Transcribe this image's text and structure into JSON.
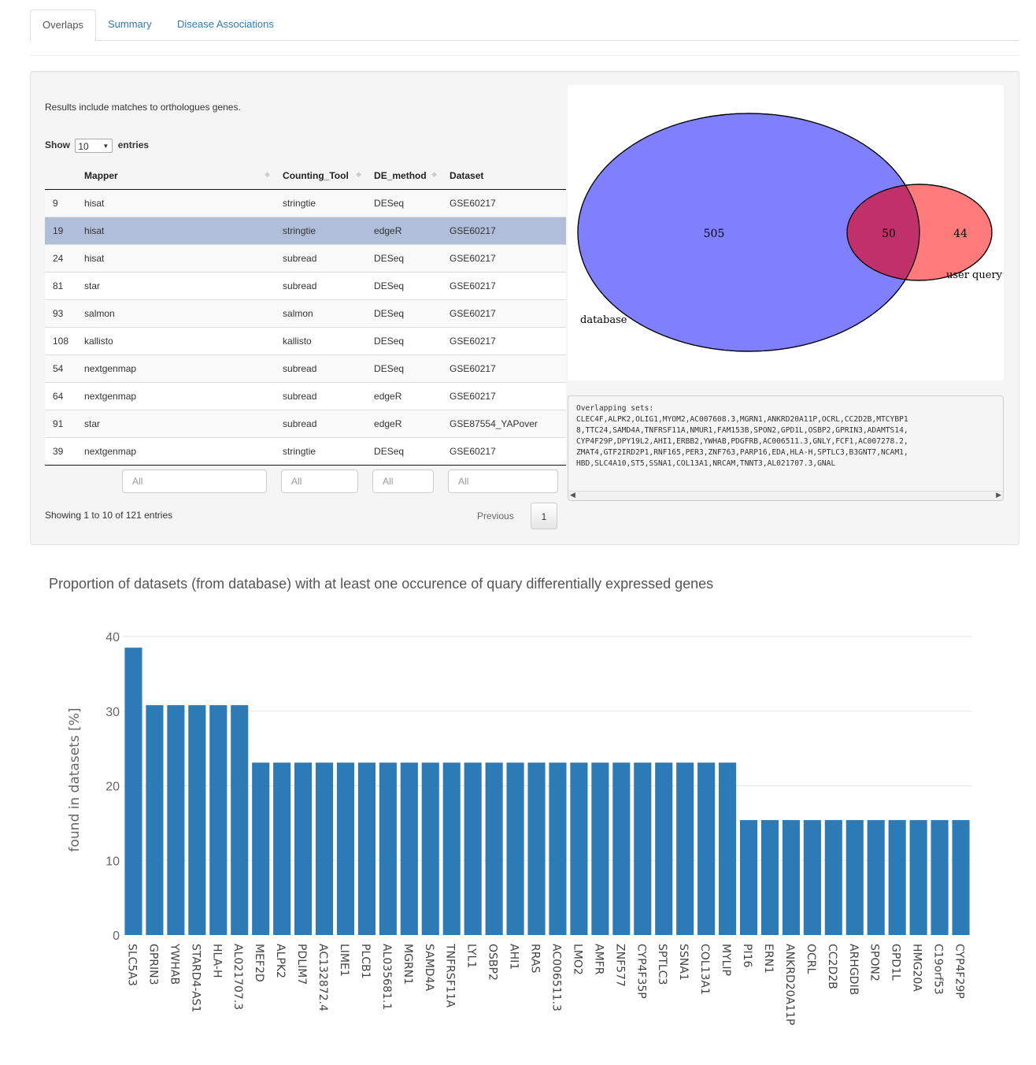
{
  "tabs": [
    {
      "label": "Overlaps",
      "active": true
    },
    {
      "label": "Summary",
      "active": false
    },
    {
      "label": "Disease Associations",
      "active": false
    }
  ],
  "results_note": "Results include matches to orthologues genes.",
  "length_control": {
    "show": "Show",
    "value": "10",
    "entries": "entries"
  },
  "table": {
    "columns": [
      "",
      "Mapper",
      "Counting_Tool",
      "DE_method",
      "Dataset"
    ],
    "rows": [
      {
        "id": "9",
        "mapper": "hisat",
        "counting": "stringtie",
        "de": "DESeq",
        "dataset": "GSE60217",
        "selected": false
      },
      {
        "id": "19",
        "mapper": "hisat",
        "counting": "stringtie",
        "de": "edgeR",
        "dataset": "GSE60217",
        "selected": true
      },
      {
        "id": "24",
        "mapper": "hisat",
        "counting": "subread",
        "de": "DESeq",
        "dataset": "GSE60217",
        "selected": false
      },
      {
        "id": "81",
        "mapper": "star",
        "counting": "subread",
        "de": "DESeq",
        "dataset": "GSE60217",
        "selected": false
      },
      {
        "id": "93",
        "mapper": "salmon",
        "counting": "salmon",
        "de": "DESeq",
        "dataset": "GSE60217",
        "selected": false
      },
      {
        "id": "108",
        "mapper": "kallisto",
        "counting": "kallisto",
        "de": "DESeq",
        "dataset": "GSE60217",
        "selected": false
      },
      {
        "id": "54",
        "mapper": "nextgenmap",
        "counting": "subread",
        "de": "DESeq",
        "dataset": "GSE60217",
        "selected": false
      },
      {
        "id": "64",
        "mapper": "nextgenmap",
        "counting": "subread",
        "de": "edgeR",
        "dataset": "GSE60217",
        "selected": false
      },
      {
        "id": "91",
        "mapper": "star",
        "counting": "subread",
        "de": "edgeR",
        "dataset": "GSE87554_YAPover",
        "selected": false
      },
      {
        "id": "39",
        "mapper": "nextgenmap",
        "counting": "stringtie",
        "de": "DESeq",
        "dataset": "GSE60217",
        "selected": false
      }
    ],
    "filter_placeholder": "All",
    "info": "Showing 1 to 10 of 121 entries",
    "previous": "Previous",
    "page": "1"
  },
  "venn": {
    "database_label": "database",
    "query_label": "user query",
    "only_database": "505",
    "overlap": "50",
    "only_query": "44",
    "colors": {
      "database": "#8080ff",
      "query": "#ff7b7b",
      "overlap": "#c0306b"
    }
  },
  "overlapping_sets": {
    "header": "Overlapping sets:",
    "lines": [
      "CLEC4F,ALPK2,OLIG1,MYOM2,AC007608.3,MGRN1,ANKRD20A11P,OCRL,CC2D2B,MTCYBP1",
      "8,TTC24,SAMD4A,TNFRSF11A,NMUR1,FAM153B,SPON2,GPD1L,OSBP2,GPRIN3,ADAMTS14,",
      "CYP4F29P,DPY19L2,AHI1,ERBB2,YWHAB,PDGFRB,AC006511.3,GNLY,FCF1,AC007278.2,",
      "ZMAT4,GTF2IRD2P1,RNF165,PER3,ZNF763,PARP16,EDA,HLA-H,SPTLC3,B3GNT7,NCAM1,",
      "HBD,SLC4A10,ST5,SSNA1,COL13A1,NRCAM,TNNT3,AL021707.3,GNAL"
    ]
  },
  "plot_title": "Proportion of datasets (from database) with at least one occurence of quary differentially expressed genes",
  "chart_data": {
    "type": "bar",
    "ylabel": "found in datasets [%]",
    "ylim": [
      0,
      40
    ],
    "yticks": [
      0,
      10,
      20,
      30,
      40
    ],
    "grid": true,
    "color": "#2c7bb6",
    "categories": [
      "SLC5A3",
      "GPRIN3",
      "YWHAB",
      "STARD4-AS1",
      "HLA-H",
      "AL021707.3",
      "MEF2D",
      "ALPK2",
      "PDLIM7",
      "AC132872.4",
      "LIME1",
      "PLCB1",
      "AL035681.1",
      "MGRN1",
      "SAMD4A",
      "TNFRSF11A",
      "LYL1",
      "OSBP2",
      "AHI1",
      "RRAS",
      "AC006511.3",
      "LMO2",
      "AMFR",
      "ZNF577",
      "CYP4F35P",
      "SPTLC3",
      "SSNA1",
      "COL13A1",
      "MYLIP",
      "PI16",
      "ERN1",
      "ANKRD20A11P",
      "OCRL",
      "CC2D2B",
      "ARHGDIB",
      "SPON2",
      "GPD1L",
      "HMG20A",
      "C19orf53",
      "CYP4F29P"
    ],
    "values": [
      38.5,
      30.8,
      30.8,
      30.8,
      30.8,
      30.8,
      23.1,
      23.1,
      23.1,
      23.1,
      23.1,
      23.1,
      23.1,
      23.1,
      23.1,
      23.1,
      23.1,
      23.1,
      23.1,
      23.1,
      23.1,
      23.1,
      23.1,
      23.1,
      23.1,
      23.1,
      23.1,
      23.1,
      23.1,
      15.4,
      15.4,
      15.4,
      15.4,
      15.4,
      15.4,
      15.4,
      15.4,
      15.4,
      15.4,
      15.4
    ]
  }
}
